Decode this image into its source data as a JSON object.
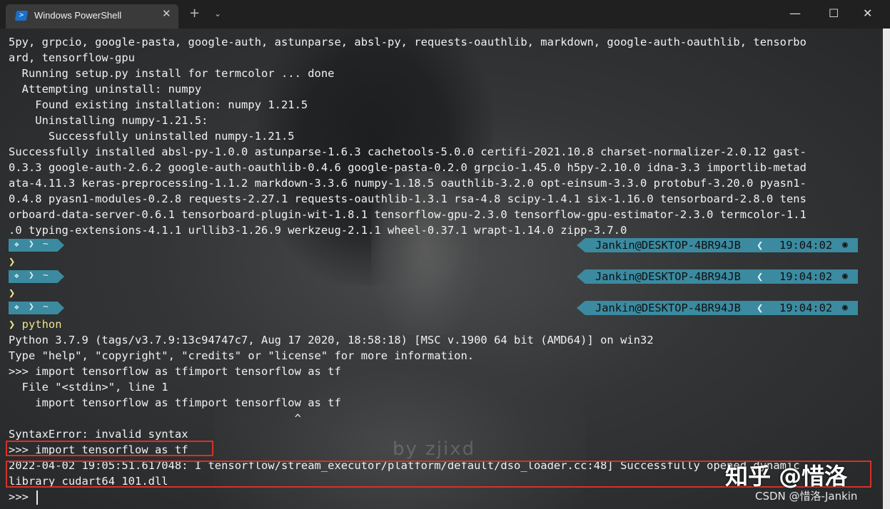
{
  "titlebar": {
    "tab_title": "Windows PowerShell",
    "tab_icon": "powershell-icon",
    "close_tab": "✕",
    "new_tab": "+",
    "dropdown": "⌄",
    "minimize": "—",
    "maximize": "☐",
    "close": "✕"
  },
  "terminal": {
    "lines": [
      "5py, grpcio, google-pasta, google-auth, astunparse, absl-py, requests-oauthlib, markdown, google-auth-oauthlib, tensorbo",
      "ard, tensorflow-gpu",
      "  Running setup.py install for termcolor ... done",
      "  Attempting uninstall: numpy",
      "    Found existing installation: numpy 1.21.5",
      "    Uninstalling numpy-1.21.5:",
      "      Successfully uninstalled numpy-1.21.5",
      "Successfully installed absl-py-1.0.0 astunparse-1.6.3 cachetools-5.0.0 certifi-2021.10.8 charset-normalizer-2.0.12 gast-",
      "0.3.3 google-auth-2.6.2 google-auth-oauthlib-0.4.6 google-pasta-0.2.0 grpcio-1.45.0 h5py-2.10.0 idna-3.3 importlib-metad",
      "ata-4.11.3 keras-preprocessing-1.1.2 markdown-3.3.6 numpy-1.18.5 oauthlib-3.2.0 opt-einsum-3.3.0 protobuf-3.20.0 pyasn1-",
      "0.4.8 pyasn1-modules-0.2.8 requests-2.27.1 requests-oauthlib-1.3.1 rsa-4.8 scipy-1.4.1 six-1.16.0 tensorboard-2.8.0 tens",
      "orboard-data-server-0.6.1 tensorboard-plugin-wit-1.8.1 tensorflow-gpu-2.3.0 tensorflow-gpu-estimator-2.3.0 termcolor-1.1",
      ".0 typing-extensions-4.1.1 urllib3-1.26.9 werkzeug-2.1.1 wheel-0.37.1 wrapt-1.14.0 zipp-3.7.0"
    ],
    "prompt": {
      "user_host": "Jankin@DESKTOP-4BR94JB",
      "time": "19:04:02",
      "dir": "~",
      "chevron": "❯",
      "command": "python"
    },
    "python_lines": [
      "Python 3.7.9 (tags/v3.7.9:13c94747c7, Aug 17 2020, 18:58:18) [MSC v.1900 64 bit (AMD64)] on win32",
      "Type \"help\", \"copyright\", \"credits\" or \"license\" for more information.",
      ">>> import tensorflow as tfimport tensorflow as tf",
      "  File \"<stdin>\", line 1",
      "    import tensorflow as tfimport tensorflow as tf",
      "                                           ^",
      "SyntaxError: invalid syntax",
      ">>> import tensorflow as tf",
      "2022-04-02 19:05:51.617048: I tensorflow/stream_executor/platform/default/dso_loader.cc:48] Successfully opened dynamic",
      "library cudart64_101.dll",
      ">>> "
    ]
  },
  "watermarks": {
    "zhihu": "知乎 @惜洛",
    "csdn": "CSDN @惜洛-Jankin",
    "by": "by zjixd"
  },
  "colors": {
    "prompt_segment": "#3b8aa0",
    "chevron": "#f0e28a",
    "highlight_box": "#d93025"
  }
}
